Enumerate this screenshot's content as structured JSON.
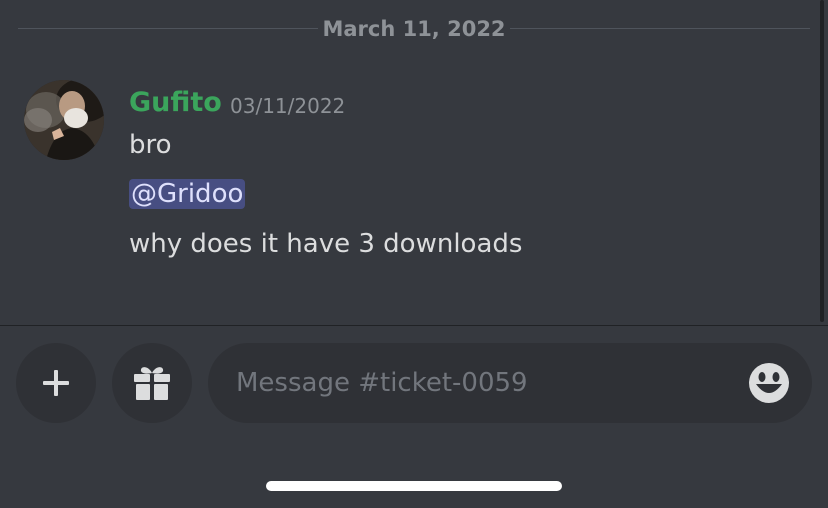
{
  "chat": {
    "date_divider": "March 11, 2022",
    "message": {
      "username": "Gufito",
      "timestamp": "03/11/2022",
      "lines": [
        "bro",
        "why does it have 3 downloads"
      ],
      "mention": "@Gridoo",
      "username_color": "#3ba55c"
    }
  },
  "composer": {
    "placeholder": "Message #ticket-0059",
    "icons": {
      "add": "plus-icon",
      "gift": "gift-icon",
      "emoji": "smiley-icon"
    }
  },
  "colors": {
    "background": "#36393f",
    "input_background": "#2f3136",
    "mention_background": "#474e82"
  }
}
